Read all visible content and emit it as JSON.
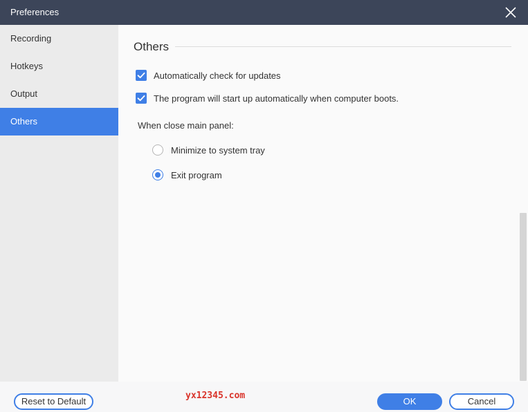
{
  "window": {
    "title": "Preferences"
  },
  "sidebar": {
    "items": [
      {
        "label": "Recording"
      },
      {
        "label": "Hotkeys"
      },
      {
        "label": "Output"
      },
      {
        "label": "Others"
      }
    ],
    "active_index": 3
  },
  "section": {
    "title": "Others",
    "checkboxes": [
      {
        "label": "Automatically check for updates",
        "checked": true
      },
      {
        "label": "The program will start up automatically when computer boots.",
        "checked": true
      }
    ],
    "close_panel": {
      "label": "When close main panel:",
      "options": [
        {
          "label": "Minimize to system tray",
          "selected": false
        },
        {
          "label": "Exit program",
          "selected": true
        }
      ]
    }
  },
  "footer": {
    "reset_label": "Reset to Default",
    "watermark": "yx12345.com",
    "ok_label": "OK",
    "cancel_label": "Cancel"
  },
  "colors": {
    "titlebar": "#3c4559",
    "accent": "#3f7fe6",
    "sidebar_bg": "#ebebeb",
    "watermark": "#d9342b"
  },
  "icons": [
    "close-icon",
    "checkmark-icon"
  ]
}
